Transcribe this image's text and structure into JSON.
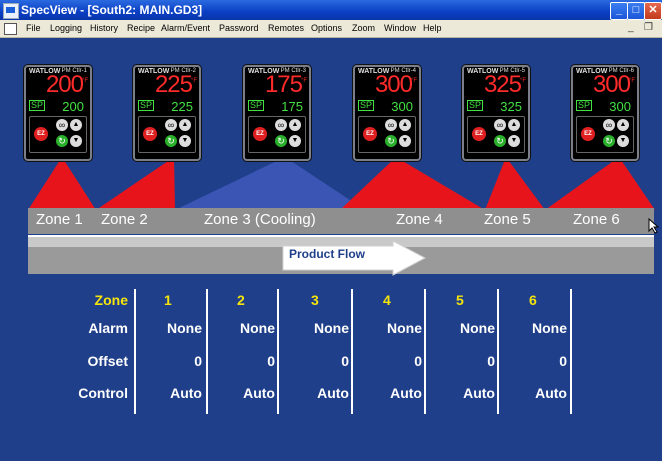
{
  "window": {
    "title": "SpecView - [South2: MAIN.GD3]"
  },
  "menu": [
    "File",
    "Logging",
    "History",
    "Recipe",
    "Alarm/Event",
    "Password",
    "Remotes",
    "Options",
    "Zoom",
    "Window",
    "Help"
  ],
  "controllers": [
    {
      "brand": "WATLOW",
      "name": "PM Ctlr-1",
      "pv": "200",
      "unit": "°F",
      "sp_tag": "SP",
      "sp": "200",
      "ez": "EZ"
    },
    {
      "brand": "WATLOW",
      "name": "PM Ctlr-2",
      "pv": "225",
      "unit": "°F",
      "sp_tag": "SP",
      "sp": "225",
      "ez": "EZ"
    },
    {
      "brand": "WATLOW",
      "name": "PM Ctlr-3",
      "pv": "175",
      "unit": "°F",
      "sp_tag": "SP",
      "sp": "175",
      "ez": "EZ"
    },
    {
      "brand": "WATLOW",
      "name": "PM Ctlr-4",
      "pv": "300",
      "unit": "°F",
      "sp_tag": "SP",
      "sp": "300",
      "ez": "EZ"
    },
    {
      "brand": "WATLOW",
      "name": "PM Ctlr-5",
      "pv": "325",
      "unit": "°F",
      "sp_tag": "SP",
      "sp": "325",
      "ez": "EZ"
    },
    {
      "brand": "WATLOW",
      "name": "PM Ctlr-6",
      "pv": "300",
      "unit": "°F",
      "sp_tag": "SP",
      "sp": "300",
      "ez": "EZ"
    }
  ],
  "zones": [
    "Zone 1",
    "Zone 2",
    "Zone 3 (Cooling)",
    "Zone 4",
    "Zone 5",
    "Zone 6"
  ],
  "product_flow": "Product Flow",
  "table": {
    "labels": {
      "zone": "Zone",
      "alarm": "Alarm",
      "offset": "Offset",
      "control": "Control"
    },
    "columns": [
      {
        "zone": "1",
        "alarm": "None",
        "offset": "0",
        "control": "Auto"
      },
      {
        "zone": "2",
        "alarm": "None",
        "offset": "0",
        "control": "Auto"
      },
      {
        "zone": "3",
        "alarm": "None",
        "offset": "0",
        "control": "Auto"
      },
      {
        "zone": "4",
        "alarm": "None",
        "offset": "0",
        "control": "Auto"
      },
      {
        "zone": "5",
        "alarm": "None",
        "offset": "0",
        "control": "Auto"
      },
      {
        "zone": "6",
        "alarm": "None",
        "offset": "0",
        "control": "Auto"
      }
    ]
  },
  "colors": {
    "background": "#1f3f8a",
    "heat": "#e8141c",
    "cool": "#3a55b4",
    "pv": "#ff2a2a",
    "sp": "#42e042",
    "header": "#f5e40b"
  }
}
